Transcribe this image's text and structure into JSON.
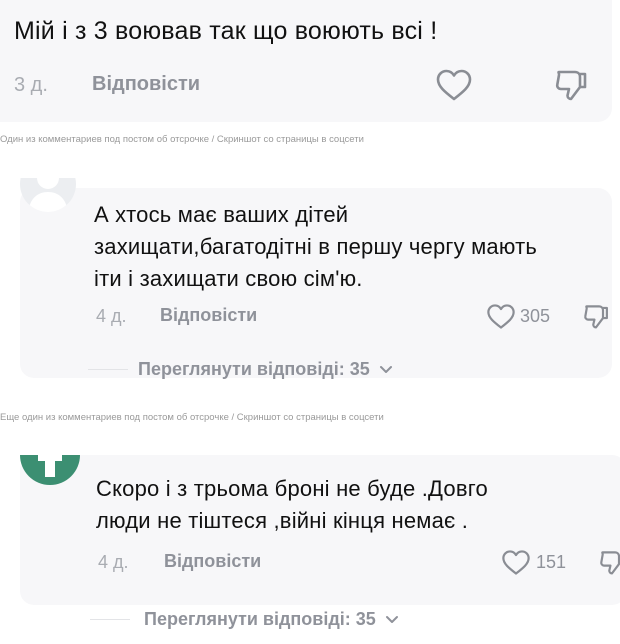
{
  "comments": [
    {
      "text": "Мій і з 3 воював так що воюють всі !",
      "time": "3 д.",
      "reply_label": "Відповісти",
      "caption": "Один из комментариев под постом об отсрочке / Скриншот со страницы в соцсети"
    },
    {
      "text_lines": [
        "А хтось має ваших дітей",
        "захищати,багатодітні в першу чергу мають",
        "іти і захищати свою сім'ю."
      ],
      "time": "4 д.",
      "reply_label": "Відповісти",
      "likes": "305",
      "view_replies": "Переглянути відповіді: 35",
      "caption": "Еще один из комментариев под постом об отсрочке / Скриншот со страницы в соцсети"
    },
    {
      "text_lines": [
        "Скоро і з трьома броні не буде .Довго",
        "люди не тіштеся ,війні кінця немає ."
      ],
      "time": "4 д.",
      "reply_label": "Відповісти",
      "likes": "151",
      "view_replies": "Переглянути відповіді: 35"
    }
  ],
  "icons": {
    "like": "heart-icon",
    "dislike": "thumbs-down-icon",
    "chevron": "chevron-down-icon"
  },
  "colors": {
    "avatar_green": "#3c8f72",
    "muted_text": "#8f929a"
  }
}
